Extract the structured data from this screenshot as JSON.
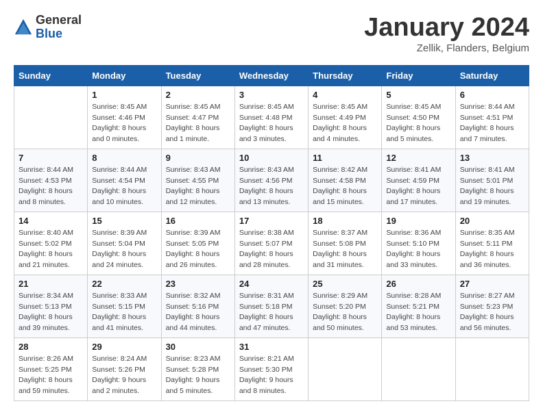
{
  "header": {
    "logo_general": "General",
    "logo_blue": "Blue",
    "main_title": "January 2024",
    "subtitle": "Zellik, Flanders, Belgium"
  },
  "days_of_week": [
    "Sunday",
    "Monday",
    "Tuesday",
    "Wednesday",
    "Thursday",
    "Friday",
    "Saturday"
  ],
  "weeks": [
    [
      {
        "day": "",
        "info": ""
      },
      {
        "day": "1",
        "info": "Sunrise: 8:45 AM\nSunset: 4:46 PM\nDaylight: 8 hours\nand 0 minutes."
      },
      {
        "day": "2",
        "info": "Sunrise: 8:45 AM\nSunset: 4:47 PM\nDaylight: 8 hours\nand 1 minute."
      },
      {
        "day": "3",
        "info": "Sunrise: 8:45 AM\nSunset: 4:48 PM\nDaylight: 8 hours\nand 3 minutes."
      },
      {
        "day": "4",
        "info": "Sunrise: 8:45 AM\nSunset: 4:49 PM\nDaylight: 8 hours\nand 4 minutes."
      },
      {
        "day": "5",
        "info": "Sunrise: 8:45 AM\nSunset: 4:50 PM\nDaylight: 8 hours\nand 5 minutes."
      },
      {
        "day": "6",
        "info": "Sunrise: 8:44 AM\nSunset: 4:51 PM\nDaylight: 8 hours\nand 7 minutes."
      }
    ],
    [
      {
        "day": "7",
        "info": "Sunrise: 8:44 AM\nSunset: 4:53 PM\nDaylight: 8 hours\nand 8 minutes."
      },
      {
        "day": "8",
        "info": "Sunrise: 8:44 AM\nSunset: 4:54 PM\nDaylight: 8 hours\nand 10 minutes."
      },
      {
        "day": "9",
        "info": "Sunrise: 8:43 AM\nSunset: 4:55 PM\nDaylight: 8 hours\nand 12 minutes."
      },
      {
        "day": "10",
        "info": "Sunrise: 8:43 AM\nSunset: 4:56 PM\nDaylight: 8 hours\nand 13 minutes."
      },
      {
        "day": "11",
        "info": "Sunrise: 8:42 AM\nSunset: 4:58 PM\nDaylight: 8 hours\nand 15 minutes."
      },
      {
        "day": "12",
        "info": "Sunrise: 8:41 AM\nSunset: 4:59 PM\nDaylight: 8 hours\nand 17 minutes."
      },
      {
        "day": "13",
        "info": "Sunrise: 8:41 AM\nSunset: 5:01 PM\nDaylight: 8 hours\nand 19 minutes."
      }
    ],
    [
      {
        "day": "14",
        "info": "Sunrise: 8:40 AM\nSunset: 5:02 PM\nDaylight: 8 hours\nand 21 minutes."
      },
      {
        "day": "15",
        "info": "Sunrise: 8:39 AM\nSunset: 5:04 PM\nDaylight: 8 hours\nand 24 minutes."
      },
      {
        "day": "16",
        "info": "Sunrise: 8:39 AM\nSunset: 5:05 PM\nDaylight: 8 hours\nand 26 minutes."
      },
      {
        "day": "17",
        "info": "Sunrise: 8:38 AM\nSunset: 5:07 PM\nDaylight: 8 hours\nand 28 minutes."
      },
      {
        "day": "18",
        "info": "Sunrise: 8:37 AM\nSunset: 5:08 PM\nDaylight: 8 hours\nand 31 minutes."
      },
      {
        "day": "19",
        "info": "Sunrise: 8:36 AM\nSunset: 5:10 PM\nDaylight: 8 hours\nand 33 minutes."
      },
      {
        "day": "20",
        "info": "Sunrise: 8:35 AM\nSunset: 5:11 PM\nDaylight: 8 hours\nand 36 minutes."
      }
    ],
    [
      {
        "day": "21",
        "info": "Sunrise: 8:34 AM\nSunset: 5:13 PM\nDaylight: 8 hours\nand 39 minutes."
      },
      {
        "day": "22",
        "info": "Sunrise: 8:33 AM\nSunset: 5:15 PM\nDaylight: 8 hours\nand 41 minutes."
      },
      {
        "day": "23",
        "info": "Sunrise: 8:32 AM\nSunset: 5:16 PM\nDaylight: 8 hours\nand 44 minutes."
      },
      {
        "day": "24",
        "info": "Sunrise: 8:31 AM\nSunset: 5:18 PM\nDaylight: 8 hours\nand 47 minutes."
      },
      {
        "day": "25",
        "info": "Sunrise: 8:29 AM\nSunset: 5:20 PM\nDaylight: 8 hours\nand 50 minutes."
      },
      {
        "day": "26",
        "info": "Sunrise: 8:28 AM\nSunset: 5:21 PM\nDaylight: 8 hours\nand 53 minutes."
      },
      {
        "day": "27",
        "info": "Sunrise: 8:27 AM\nSunset: 5:23 PM\nDaylight: 8 hours\nand 56 minutes."
      }
    ],
    [
      {
        "day": "28",
        "info": "Sunrise: 8:26 AM\nSunset: 5:25 PM\nDaylight: 8 hours\nand 59 minutes."
      },
      {
        "day": "29",
        "info": "Sunrise: 8:24 AM\nSunset: 5:26 PM\nDaylight: 9 hours\nand 2 minutes."
      },
      {
        "day": "30",
        "info": "Sunrise: 8:23 AM\nSunset: 5:28 PM\nDaylight: 9 hours\nand 5 minutes."
      },
      {
        "day": "31",
        "info": "Sunrise: 8:21 AM\nSunset: 5:30 PM\nDaylight: 9 hours\nand 8 minutes."
      },
      {
        "day": "",
        "info": ""
      },
      {
        "day": "",
        "info": ""
      },
      {
        "day": "",
        "info": ""
      }
    ]
  ]
}
